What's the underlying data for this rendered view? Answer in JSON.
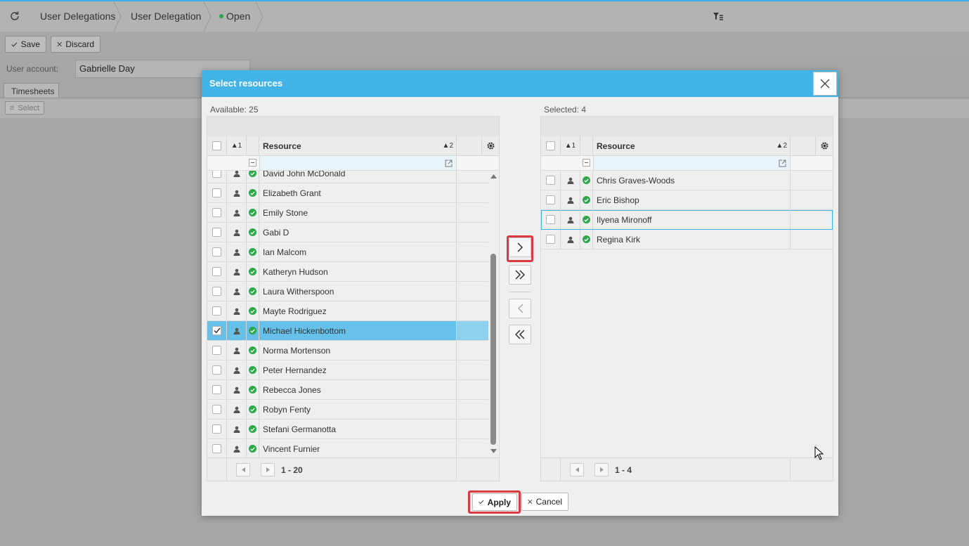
{
  "breadcrumbs": [
    "User Delegations",
    "User Delegation"
  ],
  "status": {
    "label": "Open",
    "color": "#2aa84a"
  },
  "toolbar": {
    "save_label": "Save",
    "discard_label": "Discard"
  },
  "form": {
    "user_account_label": "User account:",
    "user_account_value": "Gabrielle Day"
  },
  "tabs": [
    "Timesheets"
  ],
  "select_label": "Select",
  "dialog": {
    "title": "Select resources",
    "available_label": "Available: 25",
    "selected_label": "Selected: 4",
    "column_sort": "1",
    "column_resource": "Resource",
    "column_resource_sort": "2",
    "available_rows": [
      {
        "name": "David John McDonald",
        "checked": false
      },
      {
        "name": "Elizabeth Grant",
        "checked": false
      },
      {
        "name": "Emily Stone",
        "checked": false
      },
      {
        "name": "Gabi D",
        "checked": false
      },
      {
        "name": "Ian Malcom",
        "checked": false
      },
      {
        "name": "Katheryn Hudson",
        "checked": false
      },
      {
        "name": "Laura Witherspoon",
        "checked": false
      },
      {
        "name": "Mayte Rodriguez",
        "checked": false
      },
      {
        "name": "Michael Hickenbottom",
        "checked": true
      },
      {
        "name": "Norma Mortenson",
        "checked": false
      },
      {
        "name": "Peter Hernandez",
        "checked": false
      },
      {
        "name": "Rebecca Jones",
        "checked": false
      },
      {
        "name": "Robyn Fenty",
        "checked": false
      },
      {
        "name": "Stefani Germanotta",
        "checked": false
      },
      {
        "name": "Vincent Furnier",
        "checked": false
      }
    ],
    "selected_rows": [
      {
        "name": "Chris Graves-Woods"
      },
      {
        "name": "Eric Bishop"
      },
      {
        "name": "Ilyena Mironoff"
      },
      {
        "name": "Regina Kirk"
      }
    ],
    "available_pager": "1 - 20",
    "selected_pager": "1 - 4",
    "apply_label": "Apply",
    "cancel_label": "Cancel"
  },
  "colors": {
    "header": "#41b3e6",
    "selected_row": "#67c0e8",
    "highlight": "#d93a44",
    "status_ok": "#2aa84a"
  }
}
